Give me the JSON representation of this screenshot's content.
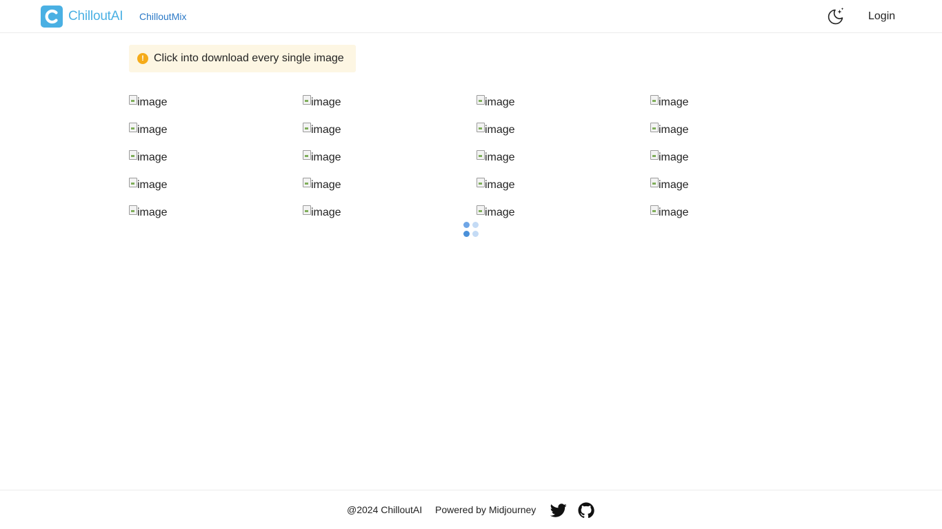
{
  "header": {
    "brand": "ChilloutAI",
    "nav_link": "ChilloutMix",
    "login_label": "Login",
    "logo_icon": "chilloutai-logo",
    "theme_icon": "moon-sparkle-icon"
  },
  "notice": {
    "text": "Click into download every single image",
    "icon": "warning-circle-icon"
  },
  "gallery": {
    "images": [
      {
        "alt": "image"
      },
      {
        "alt": "image"
      },
      {
        "alt": "image"
      },
      {
        "alt": "image"
      },
      {
        "alt": "image"
      },
      {
        "alt": "image"
      },
      {
        "alt": "image"
      },
      {
        "alt": "image"
      },
      {
        "alt": "image"
      },
      {
        "alt": "image"
      },
      {
        "alt": "image"
      },
      {
        "alt": "image"
      },
      {
        "alt": "image"
      },
      {
        "alt": "image"
      },
      {
        "alt": "image"
      },
      {
        "alt": "image"
      },
      {
        "alt": "image"
      },
      {
        "alt": "image"
      },
      {
        "alt": "image"
      },
      {
        "alt": "image"
      }
    ]
  },
  "footer": {
    "copyright": "@2024 ChilloutAI",
    "powered_prefix": "Powered by ",
    "powered_link": "Midjourney",
    "social_icons": [
      "twitter-icon",
      "github-icon"
    ]
  },
  "colors": {
    "brand": "#4ab0e3",
    "link": "#2a78c6",
    "notice_bg": "#fdf6e3",
    "warning": "#f5ab1a",
    "spinner": "#4a90d9"
  }
}
